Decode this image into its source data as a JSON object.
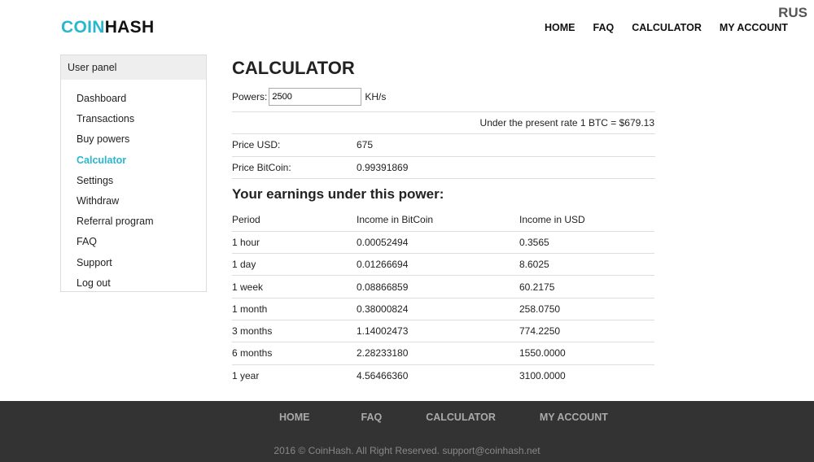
{
  "header": {
    "logo_part1": "COIN",
    "logo_part2": "HASH",
    "lang": "RUS",
    "nav": [
      "HOME",
      "FAQ",
      "CALCULATOR",
      "MY ACCOUNT"
    ]
  },
  "sidebar": {
    "title": "User panel",
    "items": [
      "Dashboard",
      "Transactions",
      "Buy powers",
      "Calculator",
      "Settings",
      "Withdraw",
      "Referral program",
      "FAQ",
      "Support",
      "Log out"
    ],
    "active": "Calculator"
  },
  "main": {
    "title": "CALCULATOR",
    "powers_label": "Powers:",
    "powers_value": "2500",
    "powers_unit": "KH/s",
    "rate_text": "Under the present rate 1 BTC = $679.13",
    "price_usd_label": "Price USD:",
    "price_usd_value": "675",
    "price_btc_label": "Price BitCoin:",
    "price_btc_value": "0.99391869",
    "earnings_title": "Your earnings under this power:",
    "table": {
      "headers": [
        "Period",
        "Income in BitCoin",
        "Income in USD"
      ],
      "rows": [
        [
          "1 hour",
          "0.00052494",
          "0.3565"
        ],
        [
          "1 day",
          "0.01266694",
          "8.6025"
        ],
        [
          "1 week",
          "0.08866859",
          "60.2175"
        ],
        [
          "1 month",
          "0.38000824",
          "258.0750"
        ],
        [
          "3 months",
          "1.14002473",
          "774.2250"
        ],
        [
          "6 months",
          "2.28233180",
          "1550.0000"
        ],
        [
          "1 year",
          "4.56466360",
          "3100.0000"
        ]
      ]
    }
  },
  "footer": {
    "nav": [
      "HOME",
      "FAQ",
      "CALCULATOR",
      "MY ACCOUNT"
    ],
    "copyright": "2016 © CoinHash. All Right Reserved. support@coinhash.net"
  },
  "colors": {
    "accent": "#29b6cf",
    "footer_bg": "#333333"
  }
}
